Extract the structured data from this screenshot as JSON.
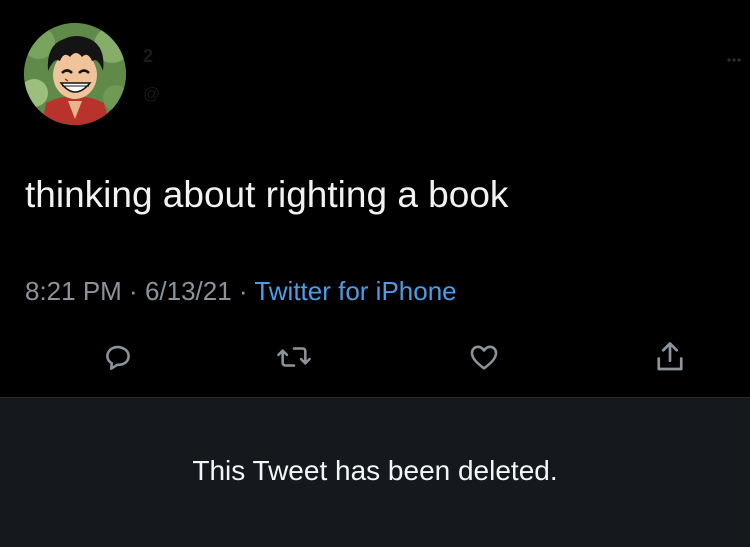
{
  "tweet": {
    "author": {
      "name": "2",
      "handle": "@",
      "avatar": "avatar-image"
    },
    "text": "thinking about righting a book",
    "meta": {
      "time": "8:21 PM",
      "separator_1": " · ",
      "date": "6/13/21",
      "separator_2": " · ",
      "source": "Twitter for iPhone"
    },
    "actions": {
      "reply": "reply-icon",
      "retweet": "retweet-icon",
      "like": "heart-icon",
      "share": "share-icon"
    },
    "more": "ellipsis-icon"
  },
  "banner": {
    "text": "This Tweet has been deleted."
  },
  "colors": {
    "background": "#000000",
    "text": "#f2f2f2",
    "meta": "#8b939b",
    "link": "#4e9be6",
    "banner_bg": "#15181c",
    "icon": "#8b939b"
  }
}
